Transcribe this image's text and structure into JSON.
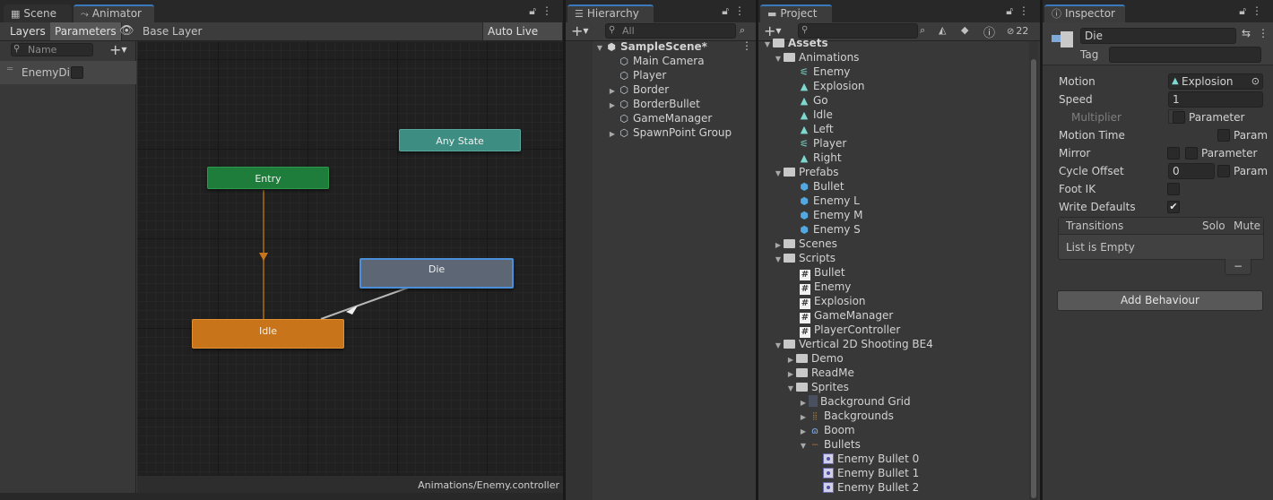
{
  "animator_window": {
    "tabs": [
      "Scene",
      "Animator"
    ],
    "layers_tab": "Layers",
    "parameters_tab": "Parameters",
    "breadcrumb": "Base Layer",
    "auto_live_link": "Auto Live Link",
    "search_placeholder": "Name",
    "parameter": "EnemyDie",
    "states": {
      "any_state": "Any State",
      "entry": "Entry",
      "die": "Die",
      "idle": "Idle"
    },
    "footer_path": "Animations/Enemy.controller"
  },
  "hierarchy": {
    "tab": "Hierarchy",
    "search_placeholder": "All",
    "scene": "SampleScene*",
    "items": [
      "Main Camera",
      "Player",
      "Border",
      "BorderBullet",
      "GameManager",
      "SpawnPoint Group"
    ]
  },
  "project": {
    "tab": "Project",
    "hidden_count": "22",
    "tree": {
      "assets": "Assets",
      "animations": "Animations",
      "animation_items": [
        "Enemy",
        "Explosion",
        "Go",
        "Idle",
        "Left",
        "Player",
        "Right"
      ],
      "prefabs": "Prefabs",
      "prefab_items": [
        "Bullet",
        "Enemy L",
        "Enemy M",
        "Enemy S"
      ],
      "scenes": "Scenes",
      "scripts": "Scripts",
      "script_items": [
        "Bullet",
        "Enemy",
        "Explosion",
        "GameManager",
        "PlayerController"
      ],
      "vertical": "Vertical 2D Shooting BE4",
      "demo": "Demo",
      "readme": "ReadMe",
      "sprites": "Sprites",
      "background_grid": "Background Grid",
      "backgrounds": "Backgrounds",
      "boom": "Boom",
      "bullets": "Bullets",
      "bullet_items": [
        "Enemy Bullet 0",
        "Enemy Bullet 1",
        "Enemy Bullet 2"
      ]
    }
  },
  "inspector": {
    "tab": "Inspector",
    "name": "Die",
    "tag_label": "Tag",
    "motion_label": "Motion",
    "motion_value": "Explosion",
    "speed_label": "Speed",
    "speed_value": "1",
    "multiplier_label": "Multiplier",
    "parameter_label": "Parameter",
    "param_label": "Param",
    "motion_time_label": "Motion Time",
    "mirror_label": "Mirror",
    "cycle_offset_label": "Cycle Offset",
    "cycle_offset_value": "0",
    "foot_ik_label": "Foot IK",
    "write_defaults_label": "Write Defaults",
    "write_defaults_checked": true,
    "transitions_label": "Transitions",
    "solo_label": "Solo",
    "mute_label": "Mute",
    "list_empty": "List is Empty",
    "minus": "−",
    "add_behaviour": "Add Behaviour"
  },
  "colors": {
    "entry": "#1e7d3a",
    "any_state": "#3e8d82",
    "idle": "#c8741a",
    "die": "#5c6675",
    "selection": "#3a79bb"
  }
}
